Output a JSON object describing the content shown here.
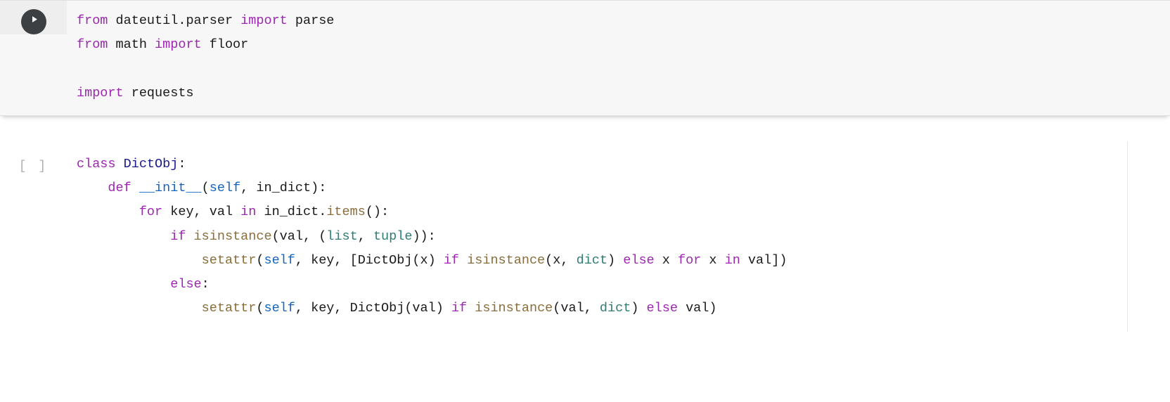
{
  "cells": [
    {
      "status": "focused",
      "prompt": "",
      "tokens": [
        [
          {
            "t": "from ",
            "c": "kw"
          },
          {
            "t": "dateutil",
            "c": "default"
          },
          {
            "t": ".",
            "c": "default"
          },
          {
            "t": "parser ",
            "c": "default"
          },
          {
            "t": "import ",
            "c": "kw"
          },
          {
            "t": "parse",
            "c": "default"
          }
        ],
        [
          {
            "t": "from ",
            "c": "kw"
          },
          {
            "t": "math ",
            "c": "default"
          },
          {
            "t": "import ",
            "c": "kw"
          },
          {
            "t": "floor",
            "c": "default"
          }
        ],
        [],
        [
          {
            "t": "import ",
            "c": "kw"
          },
          {
            "t": "requests",
            "c": "default"
          }
        ]
      ]
    },
    {
      "status": "idle",
      "prompt": "[ ]",
      "tokens": [
        [
          {
            "t": "class ",
            "c": "kw"
          },
          {
            "t": "DictObj",
            "c": "classname"
          },
          {
            "t": ":",
            "c": "default"
          }
        ],
        [
          {
            "t": "    ",
            "c": "default"
          },
          {
            "t": "def ",
            "c": "kw"
          },
          {
            "t": "__init__",
            "c": "self"
          },
          {
            "t": "(",
            "c": "default"
          },
          {
            "t": "self",
            "c": "self"
          },
          {
            "t": ", in_dict):",
            "c": "default"
          }
        ],
        [
          {
            "t": "        ",
            "c": "default"
          },
          {
            "t": "for ",
            "c": "kw"
          },
          {
            "t": "key, val ",
            "c": "default"
          },
          {
            "t": "in ",
            "c": "kw"
          },
          {
            "t": "in_dict",
            "c": "default"
          },
          {
            "t": ".",
            "c": "default"
          },
          {
            "t": "items",
            "c": "func"
          },
          {
            "t": "():",
            "c": "default"
          }
        ],
        [
          {
            "t": "            ",
            "c": "default"
          },
          {
            "t": "if ",
            "c": "kw"
          },
          {
            "t": "isinstance",
            "c": "func"
          },
          {
            "t": "(val, (",
            "c": "default"
          },
          {
            "t": "list",
            "c": "builtin"
          },
          {
            "t": ", ",
            "c": "default"
          },
          {
            "t": "tuple",
            "c": "builtin"
          },
          {
            "t": ")):",
            "c": "default"
          }
        ],
        [
          {
            "t": "                ",
            "c": "default"
          },
          {
            "t": "setattr",
            "c": "func"
          },
          {
            "t": "(",
            "c": "default"
          },
          {
            "t": "self",
            "c": "self"
          },
          {
            "t": ", key, [DictObj(x) ",
            "c": "default"
          },
          {
            "t": "if ",
            "c": "kw"
          },
          {
            "t": "isinstance",
            "c": "func"
          },
          {
            "t": "(x, ",
            "c": "default"
          },
          {
            "t": "dict",
            "c": "builtin"
          },
          {
            "t": ") ",
            "c": "default"
          },
          {
            "t": "else ",
            "c": "kw"
          },
          {
            "t": "x ",
            "c": "default"
          },
          {
            "t": "for ",
            "c": "kw"
          },
          {
            "t": "x ",
            "c": "default"
          },
          {
            "t": "in ",
            "c": "kw"
          },
          {
            "t": "val])",
            "c": "default"
          }
        ],
        [
          {
            "t": "            ",
            "c": "default"
          },
          {
            "t": "else",
            "c": "kw"
          },
          {
            "t": ":",
            "c": "default"
          }
        ],
        [
          {
            "t": "                ",
            "c": "default"
          },
          {
            "t": "setattr",
            "c": "func"
          },
          {
            "t": "(",
            "c": "default"
          },
          {
            "t": "self",
            "c": "self"
          },
          {
            "t": ", key, DictObj(val) ",
            "c": "default"
          },
          {
            "t": "if ",
            "c": "kw"
          },
          {
            "t": "isinstance",
            "c": "func"
          },
          {
            "t": "(val, ",
            "c": "default"
          },
          {
            "t": "dict",
            "c": "builtin"
          },
          {
            "t": ") ",
            "c": "default"
          },
          {
            "t": "else ",
            "c": "kw"
          },
          {
            "t": "val)",
            "c": "default"
          }
        ]
      ]
    }
  ]
}
